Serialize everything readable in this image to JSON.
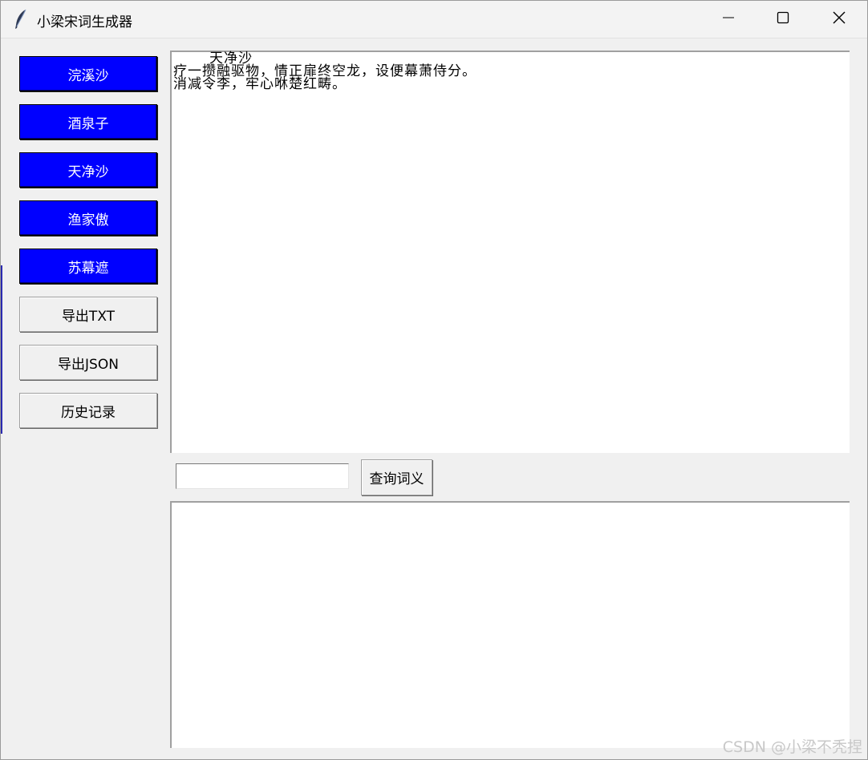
{
  "window": {
    "title": "小梁宋词生成器",
    "icon": "feather-icon"
  },
  "window_controls": {
    "minimize": "minimize-icon",
    "maximize": "maximize-icon",
    "close": "close-icon"
  },
  "sidebar": {
    "buttons": [
      {
        "label": "浣溪沙",
        "style": "blue"
      },
      {
        "label": "酒泉子",
        "style": "blue"
      },
      {
        "label": "天净沙",
        "style": "blue"
      },
      {
        "label": "渔家傲",
        "style": "blue"
      },
      {
        "label": "苏幕遮",
        "style": "blue"
      },
      {
        "label": "导出TXT",
        "style": "gray"
      },
      {
        "label": "导出JSON",
        "style": "gray"
      },
      {
        "label": "历史记录",
        "style": "gray"
      }
    ]
  },
  "output": {
    "text": "    天净沙\n疗一攒融驱物，情正扉终空龙，设便幕萧侍分。\n消减令李，牢心咻楚红畴。"
  },
  "query": {
    "input_value": "",
    "button_label": "查询词义"
  },
  "meaning": {
    "text": ""
  },
  "watermark": "CSDN @小梁不秃捏",
  "colors": {
    "accent_blue": "#0000ff",
    "window_bg": "#f0f0f0",
    "text_bg": "#ffffff"
  }
}
